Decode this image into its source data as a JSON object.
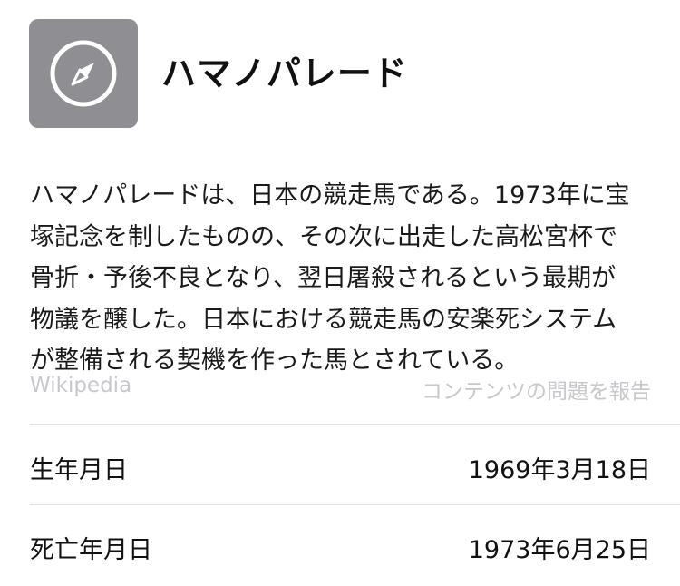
{
  "header": {
    "icon": "compass-icon",
    "icon_color": "#8e8e93",
    "title": "ハマノパレード"
  },
  "description": {
    "lines": [
      "ハマノパレードは、日本の競走馬である。1973年に宝",
      "塚記念を制したものの、その次に出走した高松宮杯で",
      "骨折・予後不良となり、翌日屠殺されるという最期が",
      "物議を醸した。日本における競走馬の安楽死システム",
      "が整備される契機を作った馬とされている。"
    ]
  },
  "source": {
    "name": "Wikipedia",
    "report_label": "コンテンツの問題を報告"
  },
  "info": [
    {
      "label": "生年月日",
      "value": "1969年3月18日"
    },
    {
      "label": "死亡年月日",
      "value": "1973年6月25日"
    }
  ],
  "colors": {
    "text": "#111111",
    "muted": "#c7c7cc",
    "divider": "#e0e0e3"
  }
}
